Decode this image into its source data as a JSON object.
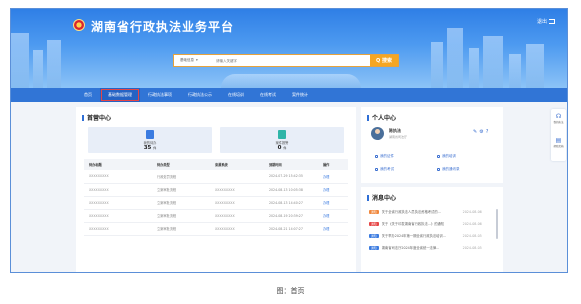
{
  "header": {
    "system_title": "湖南省行政执法业务平台",
    "logout": "退出"
  },
  "search": {
    "type": "基础信息",
    "placeholder": "请输入关键字",
    "button": "Q 搜索"
  },
  "nav": {
    "items": [
      "首页",
      "基础数据管理",
      "行政执法事项",
      "行政执法公示",
      "在线培训",
      "在线考试",
      "案件统计"
    ],
    "active_index": 1,
    "highlight_color": "#e64646"
  },
  "office": {
    "title": "首营中心",
    "cards": [
      {
        "label": "我的待办",
        "value": "35",
        "unit": "件"
      },
      {
        "label": "案件报警",
        "value": "0",
        "unit": "件"
      }
    ],
    "columns": [
      "待办标题",
      "待办类型",
      "来源系统",
      "到期时间",
      "操作"
    ],
    "rows": [
      {
        "title": "XXXXXXXXX",
        "type": "行政处罚流程",
        "source": "",
        "time": "2024-07-29 15:42:35",
        "op": "办理"
      },
      {
        "title": "XXXXXXXXX",
        "type": "立案审批流程",
        "source": "XXXXXXXXX",
        "time": "2024-08-13 10:05:38",
        "op": "办理"
      },
      {
        "title": "XXXXXXXXX",
        "type": "立案审批流程",
        "source": "XXXXXXXXX",
        "time": "2024-08-13 14:40:27",
        "op": "办理"
      },
      {
        "title": "XXXXXXXXX",
        "type": "立案审批流程",
        "source": "XXXXXXXXX",
        "time": "2024-08-19 20:39:27",
        "op": "办理"
      },
      {
        "title": "XXXXXXXXX",
        "type": "立案审批流程",
        "source": "XXXXXXXXX",
        "time": "2024-08-21 14:07:27",
        "op": "办理"
      }
    ]
  },
  "personal": {
    "title": "个人中心",
    "name": "陈执法",
    "dept": "湖南省司法厅",
    "buttons": [
      "我的证件",
      "我的培训",
      "我的考试",
      "我的通讯录"
    ]
  },
  "messages": {
    "title": "消息中心",
    "items": [
      {
        "tag": "通知",
        "tag_color": "#f0883e",
        "text": "关于全省行政执法人员执法资格考试的...",
        "date": "2024-08-06"
      },
      {
        "tag": "通知",
        "tag_color": "#e64646",
        "text": "关于《关于印发湖南省行政执法...》的通知",
        "date": "2024-08-06"
      },
      {
        "tag": "通知",
        "tag_color": "#3b7be0",
        "text": "关于举办2024年第一期全省行政执法培训...",
        "date": "2024-08-05"
      },
      {
        "tag": "通知",
        "tag_color": "#3b7be0",
        "text": "湖南省司法厅2024年度全省统一法律...",
        "date": "2024-08-05"
      }
    ]
  },
  "sidebar": {
    "items": [
      "我的执法",
      "帮助文档"
    ]
  },
  "caption": "图：首页"
}
